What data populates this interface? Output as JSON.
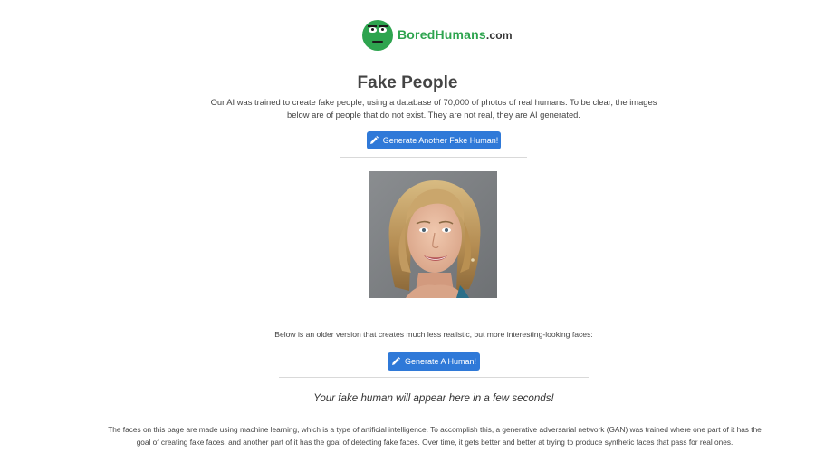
{
  "header": {
    "logo_bored": "Bored",
    "logo_humans": "Humans",
    "logo_domain": ".com",
    "logo_icon": "smiley-face-logo-icon"
  },
  "main": {
    "title": "Fake People",
    "intro": "Our AI was trained to create fake people, using a database of 70,000 of photos of real humans. To be clear, the images below are of people that do not exist. They are not real, they are AI generated.",
    "generate_fake_label": "Generate Another Fake Human!",
    "button_icon": "pencil-icon",
    "older_version_note": "Below is an older version that creates much less realistic, but more interesting-looking faces:",
    "generate_human_label": "Generate A Human!",
    "placeholder_text": "Your fake human will appear here in a few seconds!",
    "explanation": "The faces on this page are made using machine learning, which is a type of artificial intelligence. To accomplish this, a generative adversarial network (GAN) was trained where one part of it has the goal of creating fake faces, and another part of it has the goal of detecting fake faces. Over time, it gets better and better at trying to produce synthetic faces that pass for real ones."
  },
  "colors": {
    "brand_green": "#2ea44f",
    "button_blue": "#2f79d8",
    "text": "#444444"
  }
}
